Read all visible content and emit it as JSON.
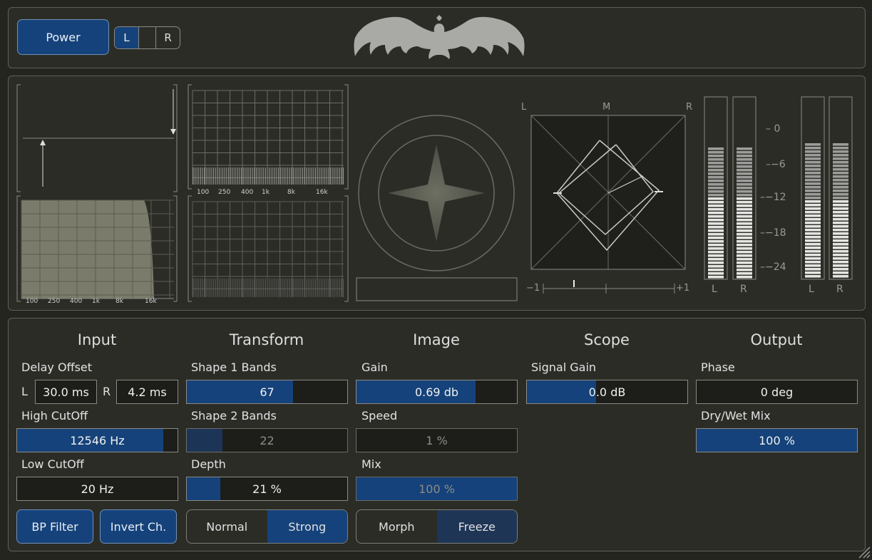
{
  "header": {
    "power_label": "Power",
    "channel_left": "L",
    "channel_right": "R"
  },
  "viz": {
    "spectrum_ticks": [
      "100",
      "250",
      "400",
      "1k",
      "8k",
      "16k"
    ],
    "corr_labels": {
      "left": "L",
      "mid": "M",
      "right": "R",
      "min": "−1",
      "max": "+1"
    },
    "meter_scale": [
      "0",
      "−6",
      "−12",
      "−18",
      "−24"
    ],
    "meter_labels": [
      "L",
      "R",
      "L",
      "R"
    ]
  },
  "input": {
    "title": "Input",
    "delay_label": "Delay Offset",
    "delay_l_label": "L",
    "delay_l": "30.0 ms",
    "delay_r_label": "R",
    "delay_r": "4.2 ms",
    "highcut_label": "High CutOff",
    "highcut": "12546 Hz",
    "highcut_level": 0.91,
    "lowcut_label": "Low CutOff",
    "lowcut": "20 Hz",
    "bp_filter": "BP Filter",
    "invert": "Invert Ch."
  },
  "transform": {
    "title": "Transform",
    "shape1_label": "Shape 1 Bands",
    "shape1": "67",
    "shape1_level": 0.66,
    "shape2_label": "Shape 2 Bands",
    "shape2": "22",
    "shape2_level": 0.22,
    "depth_label": "Depth",
    "depth": "21 %",
    "depth_level": 0.21,
    "mode_normal": "Normal",
    "mode_strong": "Strong"
  },
  "image": {
    "title": "Image",
    "gain_label": "Gain",
    "gain": "0.69 db",
    "gain_level": 0.74,
    "speed_label": "Speed",
    "speed": "1 %",
    "mix_label": "Mix",
    "mix": "100 %",
    "mix_level": 1.0,
    "morph": "Morph",
    "freeze": "Freeze"
  },
  "scope": {
    "title": "Scope",
    "signal_label": "Signal Gain",
    "signal": "0.0 dB",
    "signal_level": 0.43
  },
  "output": {
    "title": "Output",
    "phase_label": "Phase",
    "phase": "0 deg",
    "drywet_label": "Dry/Wet Mix",
    "drywet": "100 %",
    "drywet_level": 1.0
  }
}
